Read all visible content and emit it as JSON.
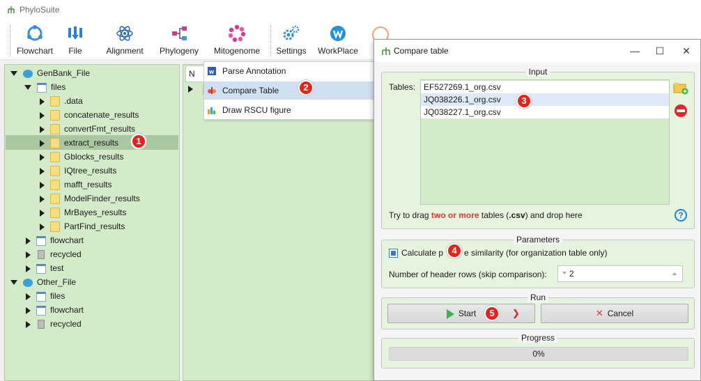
{
  "app": {
    "title": "PhyloSuite",
    "logo_icon": "phylosuite-tree-icon"
  },
  "toolbar": {
    "items": [
      {
        "label": "Flowchart",
        "icon": "flowchart-icon",
        "color": "#3a8fd6"
      },
      {
        "label": "File",
        "icon": "file-icon",
        "color": "#2f7fd1"
      },
      {
        "label": "Alignment",
        "icon": "alignment-icon",
        "color": "#2a67b8"
      },
      {
        "label": "Phylogeny",
        "icon": "phylogeny-icon",
        "color": "#e0338a"
      },
      {
        "label": "Mitogenome",
        "icon": "mitogenome-icon",
        "color": "#d93b8c"
      },
      {
        "label": "Settings",
        "icon": "settings-icon",
        "color": "#2f8fd6"
      },
      {
        "label": "WorkPlace",
        "icon": "workplace-icon",
        "color": "#1f94d8"
      }
    ]
  },
  "tree": {
    "root1": "GenBank_File",
    "files": "files",
    "file_children": [
      ".data",
      "concatenate_results",
      "convertFmt_results",
      "extract_results",
      "Gblocks_results",
      "IQtree_results",
      "mafft_results",
      "ModelFinder_results",
      "MrBayes_results",
      "PartFind_results"
    ],
    "flowchart": "flowchart",
    "recycled": "recycled",
    "test": "test",
    "root2": "Other_File",
    "files2": "files",
    "flowchart2": "flowchart",
    "recycled2": "recycled"
  },
  "panel": {
    "header_text": "N",
    "header_badge": "w"
  },
  "menu": {
    "items": [
      "Parse Annotation",
      "Compare Table",
      "Draw RSCU figure"
    ]
  },
  "badges": [
    "1",
    "2",
    "3",
    "4",
    "5"
  ],
  "dialog": {
    "title": "Compare table",
    "minimize": "—",
    "maximize": "☐",
    "close": "✕",
    "input": {
      "group_title": "Input",
      "tables_label": "Tables:",
      "files": [
        "EF527269.1_org.csv",
        "JQ038226.1_org.csv",
        "JQ038227.1_org.csv"
      ],
      "hint_prefix": "Try to drag ",
      "hint_red": "two or more",
      "hint_mid": " tables (",
      "hint_bold": ".csv",
      "hint_suffix": ") and drop here",
      "help": "?"
    },
    "parameters": {
      "group_title": "Parameters",
      "checkbox_left": "Calculate p",
      "checkbox_right": "e similarity (for organization table only)",
      "checked": true,
      "header_rows_label": "Number of header rows (skip comparison):",
      "header_rows_value": "2"
    },
    "run": {
      "group_title": "Run",
      "start_label": "Start",
      "cancel_label": "Cancel"
    },
    "progress": {
      "group_title": "Progress",
      "value_text": "0%",
      "value": 0
    }
  }
}
